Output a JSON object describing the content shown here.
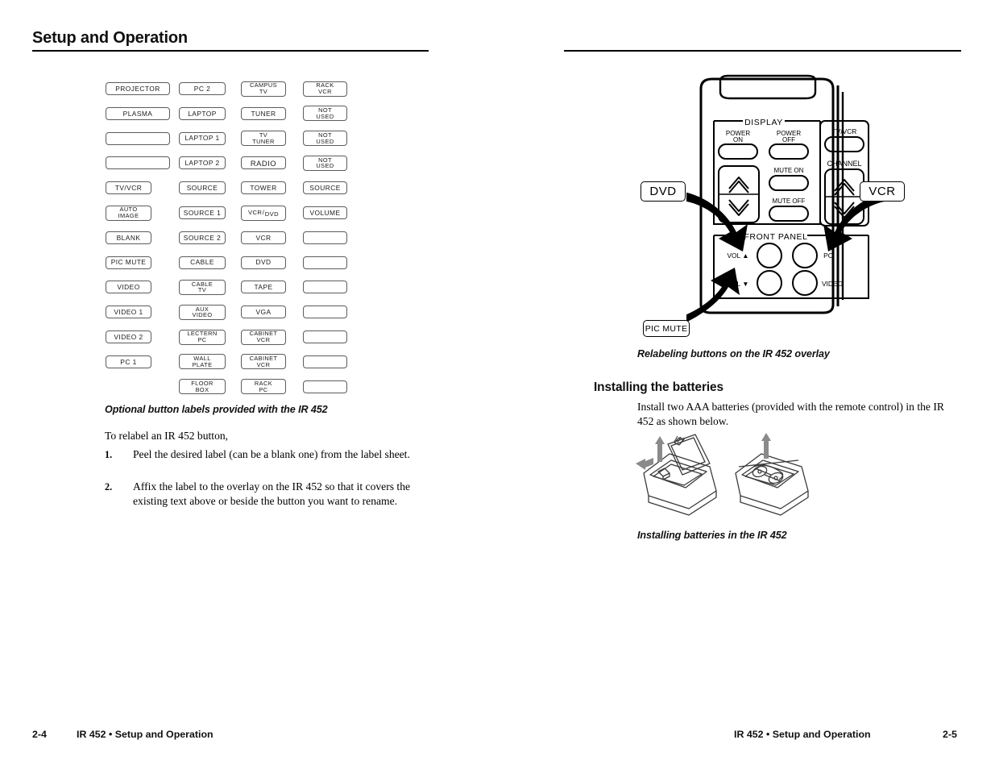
{
  "document": {
    "title": "Setup and Operation",
    "product": "IR 452"
  },
  "left_page": {
    "header": "Setup and Operation",
    "label_grid": {
      "columns": [
        {
          "name": "column-1",
          "labels": [
            {
              "lines": [
                "PROJECTOR"
              ],
              "wide": true
            },
            {
              "lines": [
                "PLASMA"
              ],
              "wide": true
            },
            {
              "lines": [
                ""
              ],
              "wide": true,
              "blank": true
            },
            {
              "lines": [
                ""
              ],
              "wide": true,
              "blank": true
            },
            {
              "lines": [
                "TV/VCR"
              ]
            },
            {
              "lines": [
                "AUTO",
                "IMAGE"
              ]
            },
            {
              "lines": [
                "BLANK"
              ]
            },
            {
              "lines": [
                "PIC MUTE"
              ]
            },
            {
              "lines": [
                "VIDEO"
              ]
            },
            {
              "lines": [
                "VIDEO 1"
              ]
            },
            {
              "lines": [
                "VIDEO 2"
              ]
            },
            {
              "lines": [
                "PC 1"
              ]
            }
          ]
        },
        {
          "name": "column-2",
          "labels": [
            {
              "lines": [
                "PC 2"
              ]
            },
            {
              "lines": [
                "LAPTOP"
              ]
            },
            {
              "lines": [
                "LAPTOP 1"
              ]
            },
            {
              "lines": [
                "LAPTOP 2"
              ]
            },
            {
              "lines": [
                "SOURCE"
              ]
            },
            {
              "lines": [
                "SOURCE 1"
              ]
            },
            {
              "lines": [
                "SOURCE 2"
              ]
            },
            {
              "lines": [
                "CABLE"
              ]
            },
            {
              "lines": [
                "CABLE",
                "TV"
              ]
            },
            {
              "lines": [
                "AUX",
                "VIDEO"
              ]
            },
            {
              "lines": [
                "LECTERN",
                "PC"
              ]
            },
            {
              "lines": [
                "WALL",
                "PLATE"
              ]
            },
            {
              "lines": [
                "FLOOR",
                "BOX"
              ]
            }
          ]
        },
        {
          "name": "column-3",
          "labels": [
            {
              "lines": [
                "CAMPUS",
                "TV"
              ]
            },
            {
              "lines": [
                "TUNER"
              ]
            },
            {
              "lines": [
                "TV",
                "TUNER"
              ]
            },
            {
              "lines": [
                "RADIO"
              ],
              "big": true
            },
            {
              "lines": [
                "TOWER"
              ]
            },
            {
              "fraction": {
                "top": "VCR",
                "slash": "/",
                "bottom": "DVD"
              }
            },
            {
              "lines": [
                "VCR"
              ]
            },
            {
              "lines": [
                "DVD"
              ]
            },
            {
              "lines": [
                "TAPE"
              ]
            },
            {
              "lines": [
                "VGA"
              ]
            },
            {
              "lines": [
                "CABINET",
                "VCR"
              ]
            },
            {
              "lines": [
                "CABINET",
                "VCR"
              ]
            },
            {
              "lines": [
                "RACK",
                "PC"
              ]
            }
          ]
        },
        {
          "name": "column-4",
          "labels": [
            {
              "lines": [
                "RACK",
                "VCR"
              ]
            },
            {
              "lines": [
                "NOT",
                "USED"
              ]
            },
            {
              "lines": [
                "NOT",
                "USED"
              ]
            },
            {
              "lines": [
                "NOT",
                "USED"
              ]
            },
            {
              "lines": [
                "SOURCE"
              ]
            },
            {
              "lines": [
                "VOLUME"
              ]
            },
            {
              "lines": [
                ""
              ],
              "blank": true
            },
            {
              "lines": [
                ""
              ],
              "blank": true
            },
            {
              "lines": [
                ""
              ],
              "blank": true
            },
            {
              "lines": [
                ""
              ],
              "blank": true
            },
            {
              "lines": [
                ""
              ],
              "blank": true
            },
            {
              "lines": [
                ""
              ],
              "blank": true
            },
            {
              "lines": [
                ""
              ],
              "blank": true
            }
          ]
        }
      ]
    },
    "figure_caption": "Optional button labels provided with the IR 452",
    "intro": "To relabel an IR 452 button,",
    "steps": [
      {
        "number": "1.",
        "text": "Peel the desired label (can be a blank one) from the label sheet."
      },
      {
        "number": "2.",
        "text": "Affix the label to the overlay on the IR 452 so that it covers the existing text above or beside the button you want to rename."
      }
    ],
    "footer": {
      "page": "2-4",
      "text": "IR 452 • Setup and Operation"
    }
  },
  "right_page": {
    "remote": {
      "display_group_label": "DISPLAY",
      "front_panel_label": "FRONT PANEL",
      "buttons": [
        {
          "label": "POWER ON",
          "lines": [
            "POWER",
            "ON"
          ]
        },
        {
          "label": "POWER OFF",
          "lines": [
            "POWER",
            "OFF"
          ]
        },
        {
          "label": "MUTE ON",
          "lines": [
            "MUTE ON"
          ]
        },
        {
          "label": "MUTE OFF",
          "lines": [
            "MUTE OFF"
          ]
        },
        {
          "label": "TV/VCR",
          "lines": [
            "TV/VCR"
          ]
        },
        {
          "label": "CHANNEL",
          "lines": [
            "CHANNEL"
          ]
        },
        {
          "label": "VOL UP",
          "lines": [
            "VOL ▲"
          ]
        },
        {
          "label": "VOL DOWN",
          "lines": [
            "VOL ▼"
          ]
        },
        {
          "label": "PC",
          "lines": [
            "PC"
          ]
        },
        {
          "label": "VIDEO",
          "lines": [
            "VIDEO"
          ]
        }
      ],
      "callouts": [
        {
          "name": "dvd",
          "text": "DVD"
        },
        {
          "name": "vcr",
          "text": "VCR"
        },
        {
          "name": "pic-mute",
          "text": "PIC MUTE"
        }
      ]
    },
    "figure_caption_remote": "Relabeling buttons on the IR 452 overlay",
    "section_heading": "Installing the batteries",
    "section_body": "Install two AAA batteries (provided with the remote control) in the IR 452 as shown below.",
    "figure_caption_batteries": "Installing batteries in the IR 452",
    "footer": {
      "page": "2-5",
      "text": "IR 452 • Setup and Operation"
    }
  },
  "colors": {
    "ink": "#000000",
    "box_stroke": "#5c5c5c",
    "shade": "#d9d9d9"
  }
}
